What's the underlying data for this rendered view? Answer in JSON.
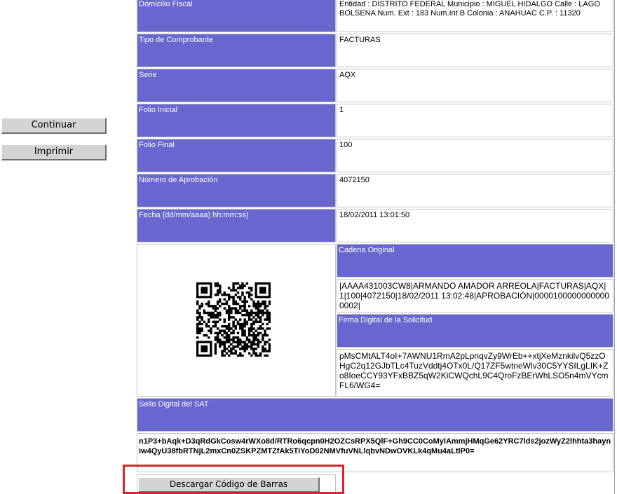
{
  "side_buttons": {
    "continuar": "Continuar",
    "imprimir": "Imprimir"
  },
  "rows": [
    {
      "label": "Domicilio Fiscal",
      "value": "Entidad : DISTRITO FEDERAL Municipio : MIGUEL HIDALGO Calle : LAGO BOLSENA Num. Ext : 183 Num.Int B Colonia : ANAHUAC C.P. : 11320"
    },
    {
      "label": "Tipo de Comprobante",
      "value": "FACTURAS"
    },
    {
      "label": "Serie",
      "value": "AQX"
    },
    {
      "label": "Folio Inicial",
      "value": "1"
    },
    {
      "label": "Folio Final",
      "value": "100"
    },
    {
      "label": "Número de Aprobación",
      "value": "4072150"
    },
    {
      "label": "Fecha (dd/mm/aaaa) hh:mm:ss)",
      "value": "18/02/2011 13:01:50"
    }
  ],
  "cadena": {
    "label": "Cadena Original",
    "value": "|AAAA431003CW8|ARMANDO AMADOR ARREOLA|FACTURAS|AQX|1|100|4072150|18/02/2011 13:02:48|APROBACIÓN|00001000000000000002|"
  },
  "firma": {
    "label": "Firma Digital de la Solicitud",
    "value": "pMsCMtALT4oI+7AWNU1RmA2pLpnqvZy9WrEb++xtjXeMznkilvQ5zzOHgC2q12GJbTLc4TuzVddtj4OTx0L/Q17ZF5wtneWlv30C5YYSILgLIK+Zo8IoeCCY93YFxBBZ5qW2KiCWQchL9C4QroFzBErWhLSO5n4mVYcmFL6/WG4="
  },
  "sello": {
    "label": "Sello Digital del SAT",
    "value": "n1P3+bAqk+D3qRdGkCosw4rWXo8d/RTRo6qcpn0H2OZCsRPX5QlF+Gh9CC0CoMylAmmjHMqGe62YRC7lds2jozWyZ2lhhta3hayniw4QyU38fbRTNjL2mxCn0ZSKPZMTZfAk5TiYoD02NMVfuVNLlqbvNDwOVKLk4qMu4aLtlP0="
  },
  "qr_icon": "qr-code",
  "download_button": "Descargar Código de Barras",
  "colors": {
    "label_bg": "#6767cf",
    "highlight": "#d3262f"
  }
}
